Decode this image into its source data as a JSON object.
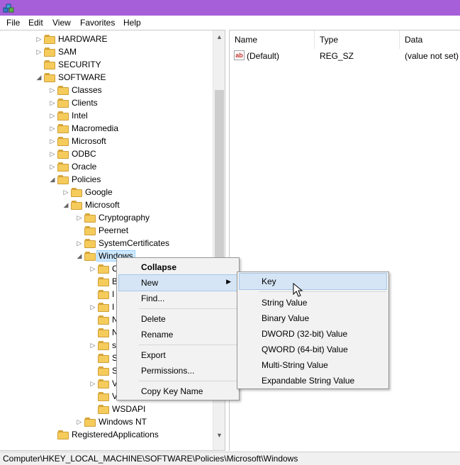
{
  "menubar": [
    "File",
    "Edit",
    "View",
    "Favorites",
    "Help"
  ],
  "tree": [
    {
      "label": "HARDWARE",
      "level": 3,
      "expander": "▷"
    },
    {
      "label": "SAM",
      "level": 3,
      "expander": "▷"
    },
    {
      "label": "SECURITY",
      "level": 3,
      "expander": ""
    },
    {
      "label": "SOFTWARE",
      "level": 3,
      "expander": "◢"
    },
    {
      "label": "Classes",
      "level": 4,
      "expander": "▷"
    },
    {
      "label": "Clients",
      "level": 4,
      "expander": "▷"
    },
    {
      "label": "Intel",
      "level": 4,
      "expander": "▷"
    },
    {
      "label": "Macromedia",
      "level": 4,
      "expander": "▷"
    },
    {
      "label": "Microsoft",
      "level": 4,
      "expander": "▷"
    },
    {
      "label": "ODBC",
      "level": 4,
      "expander": "▷"
    },
    {
      "label": "Oracle",
      "level": 4,
      "expander": "▷"
    },
    {
      "label": "Policies",
      "level": 4,
      "expander": "◢"
    },
    {
      "label": "Google",
      "level": 5,
      "expander": "▷"
    },
    {
      "label": "Microsoft",
      "level": 5,
      "expander": "◢"
    },
    {
      "label": "Cryptography",
      "level": 6,
      "expander": "▷"
    },
    {
      "label": "Peernet",
      "level": 6,
      "expander": ""
    },
    {
      "label": "SystemCertificates",
      "level": 6,
      "expander": "▷"
    },
    {
      "label": "Windows",
      "level": 6,
      "expander": "◢",
      "selected": true
    },
    {
      "label": "C",
      "level": 7,
      "expander": "▷"
    },
    {
      "label": "B",
      "level": 7,
      "expander": ""
    },
    {
      "label": "I",
      "level": 7,
      "expander": ""
    },
    {
      "label": "I",
      "level": 7,
      "expander": "▷"
    },
    {
      "label": "N",
      "level": 7,
      "expander": ""
    },
    {
      "label": "N",
      "level": 7,
      "expander": ""
    },
    {
      "label": "s",
      "level": 7,
      "expander": "▷"
    },
    {
      "label": "S",
      "level": 7,
      "expander": ""
    },
    {
      "label": "S",
      "level": 7,
      "expander": ""
    },
    {
      "label": "V",
      "level": 7,
      "expander": "▷"
    },
    {
      "label": "V",
      "level": 7,
      "expander": ""
    },
    {
      "label": "WSDAPI",
      "level": 7,
      "expander": ""
    },
    {
      "label": "Windows NT",
      "level": 6,
      "expander": "▷"
    },
    {
      "label": "RegisteredApplications",
      "level": 4,
      "expander": ""
    }
  ],
  "list": {
    "columns": [
      "Name",
      "Type",
      "Data"
    ],
    "rows": [
      {
        "name": "(Default)",
        "type": "REG_SZ",
        "data": "(value not set)",
        "icon": "ab"
      }
    ]
  },
  "context_menu": {
    "items": [
      "Collapse",
      "New",
      "Find...",
      "Delete",
      "Rename",
      "Export",
      "Permissions...",
      "Copy Key Name"
    ]
  },
  "submenu": {
    "items": [
      "Key",
      "String Value",
      "Binary Value",
      "DWORD (32-bit) Value",
      "QWORD (64-bit) Value",
      "Multi-String Value",
      "Expandable String Value"
    ]
  },
  "status": "Computer\\HKEY_LOCAL_MACHINE\\SOFTWARE\\Policies\\Microsoft\\Windows",
  "colors": {
    "titlebar": "#a65fd9",
    "selection": "#cde8ff",
    "menu_highlight": "#d5e5f5"
  }
}
